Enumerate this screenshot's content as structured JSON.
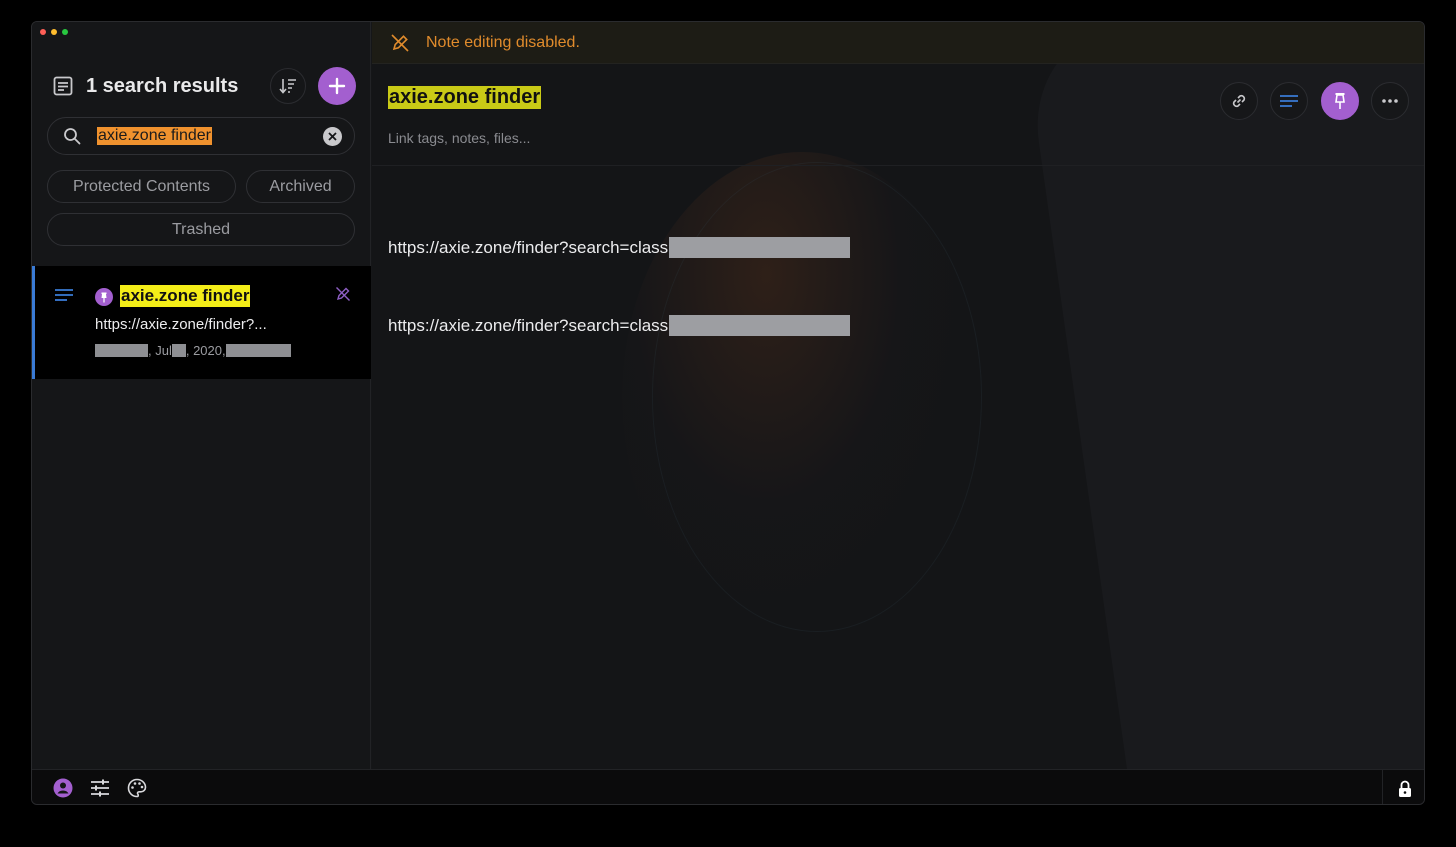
{
  "sidebar": {
    "title": "1 search results",
    "search": {
      "query": "axie.zone finder"
    },
    "filters": [
      "Protected Contents",
      "Archived",
      "Trashed"
    ],
    "note": {
      "title": "axie.zone finder",
      "snippet": "https://axie.zone/finder?...",
      "date_month": ", Jul ",
      "date_year": ", 2020, "
    }
  },
  "main": {
    "banner": "Note editing disabled.",
    "title": "axie.zone finder",
    "tags_placeholder": "Link tags, notes, files...",
    "paragraphs": [
      "https://axie.zone/finder?search=class",
      "https://axie.zone/finder?search=class"
    ]
  },
  "colors": {
    "accent": "#a35fcf",
    "highlight": "#f4ee18",
    "search_highlight": "#f0922e",
    "banner_text": "#e08b2c",
    "selection_bar": "#3a7bd5"
  },
  "icons": {
    "header": "notes-icon",
    "sort": "sort-icon",
    "add": "plus-icon",
    "search": "search-icon",
    "clear": "clear-icon",
    "note_type": "lines-icon",
    "pinned": "pin-icon",
    "no_edit": "pencil-off-icon",
    "toolbar": [
      "link-icon",
      "lines-icon",
      "pin-icon",
      "more-icon"
    ],
    "footer": [
      "account-icon",
      "settings-icon",
      "palette-icon",
      "lock-icon"
    ]
  }
}
